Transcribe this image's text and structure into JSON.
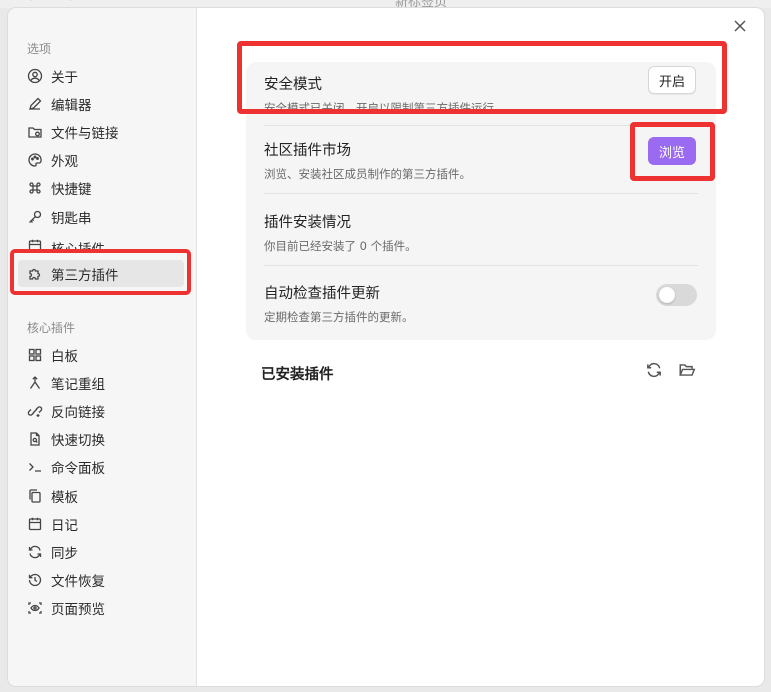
{
  "window": {
    "title": "新标签页",
    "nav_arrows": "← →"
  },
  "sidebar": {
    "options_label": "选项",
    "options": [
      {
        "label": "关于",
        "icon": "user-circle-icon"
      },
      {
        "label": "编辑器",
        "icon": "pencil-icon"
      },
      {
        "label": "文件与链接",
        "icon": "folder-link-icon"
      },
      {
        "label": "外观",
        "icon": "palette-icon"
      },
      {
        "label": "快捷键",
        "icon": "command-icon"
      },
      {
        "label": "钥匙串",
        "icon": "key-icon"
      },
      {
        "label": "核心插件",
        "icon": "calendar-icon"
      },
      {
        "label": "第三方插件",
        "icon": "puzzle-icon"
      }
    ],
    "core_label": "核心插件",
    "core": [
      {
        "label": "白板",
        "icon": "layout-grid-icon"
      },
      {
        "label": "笔记重组",
        "icon": "merge-icon"
      },
      {
        "label": "反向链接",
        "icon": "backlink-icon"
      },
      {
        "label": "快速切换",
        "icon": "file-search-icon"
      },
      {
        "label": "命令面板",
        "icon": "terminal-icon"
      },
      {
        "label": "模板",
        "icon": "copy-icon"
      },
      {
        "label": "日记",
        "icon": "calendar-icon"
      },
      {
        "label": "同步",
        "icon": "sync-icon"
      },
      {
        "label": "文件恢复",
        "icon": "history-icon"
      },
      {
        "label": "页面预览",
        "icon": "scan-eye-icon"
      }
    ]
  },
  "settings": {
    "safe_mode": {
      "title": "安全模式",
      "desc": "安全模式已关闭。开启以限制第三方插件运行。",
      "button": "开启"
    },
    "market": {
      "title": "社区插件市场",
      "desc": "浏览、安装社区成员制作的第三方插件。",
      "button": "浏览"
    },
    "install": {
      "title": "插件安装情况",
      "desc": "你目前已经安装了 0 个插件。"
    },
    "auto_update": {
      "title": "自动检查插件更新",
      "desc": "定期检查第三方插件的更新。",
      "enabled": false
    }
  },
  "installed": {
    "title": "已安装插件",
    "reload_icon": "reload-icon",
    "folder_icon": "folder-open-icon"
  },
  "colors": {
    "accent": "#9a6bf0",
    "highlight": "#ee3131",
    "toggle_off": "#d9d9d9"
  }
}
